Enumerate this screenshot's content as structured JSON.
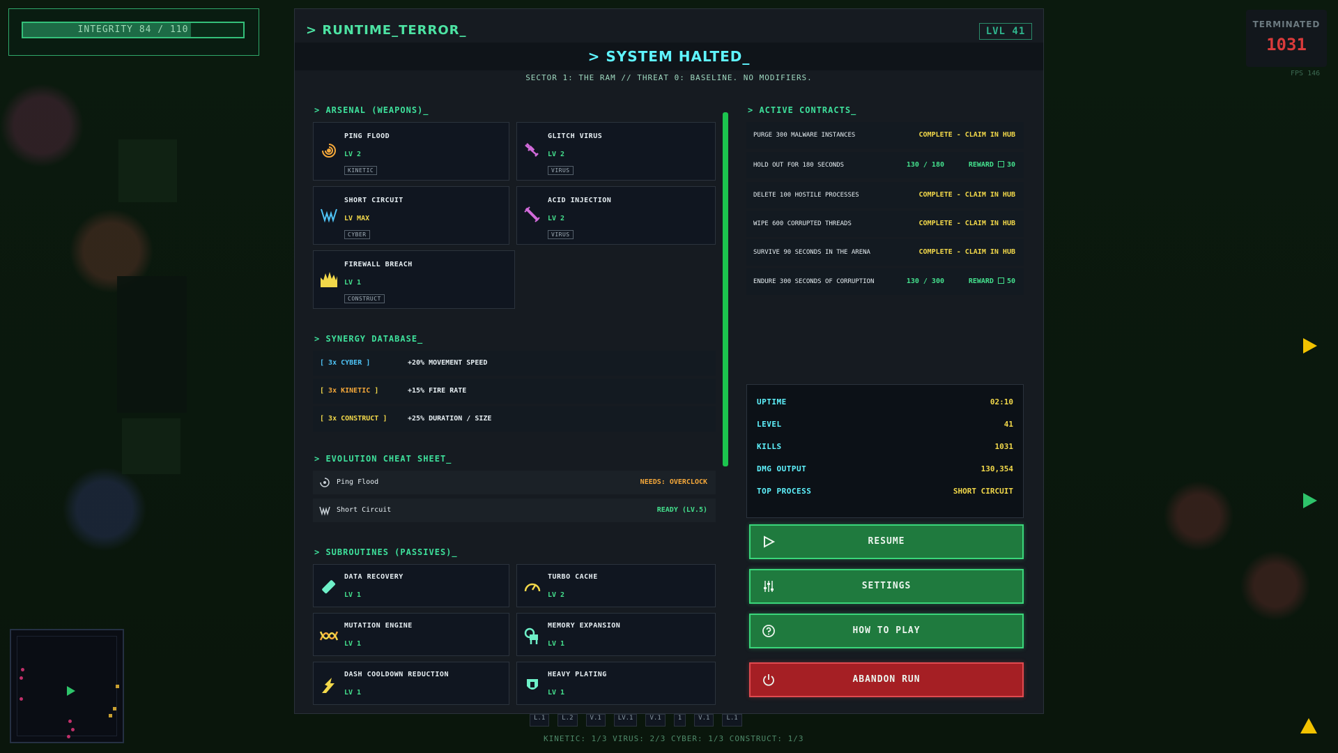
{
  "hud": {
    "integrity_label": "INTEGRITY  84 / 110",
    "integrity_value": 84,
    "integrity_max": 110,
    "terminated_label": "TERMINATED",
    "terminated_value": "1031",
    "fps": "FPS 146"
  },
  "header": {
    "game_title": "> RUNTIME_TERROR_",
    "level_badge": "LVL 41",
    "halted": "> SYSTEM HALTED_",
    "sector": "SECTOR 1: THE RAM // THREAT 0: BASELINE. NO MODIFIERS."
  },
  "arsenal": {
    "heading": "> ARSENAL (WEAPONS)_",
    "weapons": [
      {
        "name": "PING FLOOD",
        "level": "LV 2",
        "tag": "KINETIC",
        "icon": "ping-flood-icon"
      },
      {
        "name": "GLITCH VIRUS",
        "level": "LV 2",
        "tag": "VIRUS",
        "icon": "glitch-virus-icon"
      },
      {
        "name": "SHORT CIRCUIT",
        "level": "LV MAX",
        "tag": "CYBER",
        "icon": "short-circuit-icon"
      },
      {
        "name": "ACID INJECTION",
        "level": "LV 2",
        "tag": "VIRUS",
        "icon": "acid-injection-icon"
      },
      {
        "name": "FIREWALL BREACH",
        "level": "LV 1",
        "tag": "CONSTRUCT",
        "icon": "firewall-breach-icon"
      }
    ]
  },
  "synergy": {
    "heading": "> SYNERGY DATABASE_",
    "rows": [
      {
        "open": "[ ",
        "key": "3x CYBER",
        "close": " ]",
        "effect": "+20% MOVEMENT SPEED"
      },
      {
        "open": "[ ",
        "key": "3x KINETIC",
        "close": " ]",
        "effect": "+15% FIRE RATE"
      },
      {
        "open": "[ ",
        "key": "3x CONSTRUCT",
        "close": " ]",
        "effect": "+25% DURATION / SIZE"
      }
    ]
  },
  "evolution": {
    "heading": "> EVOLUTION CHEAT SHEET_",
    "rows": [
      {
        "name": "Ping Flood",
        "status": "NEEDS: OVERCLOCK"
      },
      {
        "name": "Short Circuit",
        "status": "READY (LV.5)"
      }
    ]
  },
  "passives": {
    "heading": "> SUBROUTINES (PASSIVES)_",
    "items": [
      {
        "name": "DATA RECOVERY",
        "level": "LV 1",
        "icon": "syringe-icon"
      },
      {
        "name": "TURBO CACHE",
        "level": "LV 2",
        "icon": "speedometer-icon"
      },
      {
        "name": "MUTATION ENGINE",
        "level": "LV 1",
        "icon": "dna-icon"
      },
      {
        "name": "MEMORY EXPANSION",
        "level": "LV 1",
        "icon": "ram-icon"
      },
      {
        "name": "DASH COOLDOWN REDUCTION",
        "level": "LV 1",
        "icon": "dash-icon"
      },
      {
        "name": "HEAVY PLATING",
        "level": "LV 1",
        "icon": "armor-icon"
      }
    ]
  },
  "contracts": {
    "heading": "> ACTIVE CONTRACTS_",
    "items": [
      {
        "desc": "PURGE 300 MALWARE INSTANCES",
        "status": "COMPLETE - CLAIM IN HUB"
      },
      {
        "desc": "HOLD OUT FOR 180 SECONDS",
        "progress": "130 / 180",
        "reward": "REWARD",
        "reward_value": "30"
      },
      {
        "desc": "DELETE 100 HOSTILE PROCESSES",
        "status": "COMPLETE - CLAIM IN HUB"
      },
      {
        "desc": "WIPE 600 CORRUPTED THREADS",
        "status": "COMPLETE - CLAIM IN HUB"
      },
      {
        "desc": "SURVIVE 90 SECONDS IN THE ARENA",
        "status": "COMPLETE - CLAIM IN HUB"
      },
      {
        "desc": "ENDURE 300 SECONDS OF CORRUPTION",
        "progress": "130 / 300",
        "reward": "REWARD",
        "reward_value": "50"
      }
    ]
  },
  "stats": [
    {
      "label": "UPTIME",
      "value": "02:10"
    },
    {
      "label": "LEVEL",
      "value": "41"
    },
    {
      "label": "KILLS",
      "value": "1031"
    },
    {
      "label": "DMG OUTPUT",
      "value": "130,354"
    },
    {
      "label": "TOP PROCESS",
      "value": "SHORT CIRCUIT"
    }
  ],
  "buttons": {
    "resume": "RESUME",
    "settings": "SETTINGS",
    "how_to_play": "HOW TO PLAY",
    "abandon": "ABANDON RUN"
  },
  "loadout_bar": [
    "L.1",
    "L.2",
    "V.1",
    "LV.1",
    "V.1",
    "1",
    "V.1",
    "L.1"
  ],
  "tally": "KINETIC: 1/3   VIRUS: 2/3   CYBER: 1/3   CONSTRUCT: 1/3",
  "colors": {
    "accent_green": "#3ee09b",
    "cyan": "#5ff4ff",
    "yellow": "#f2d84a",
    "danger": "#a51f24",
    "button_green": "#1f7a3e"
  }
}
